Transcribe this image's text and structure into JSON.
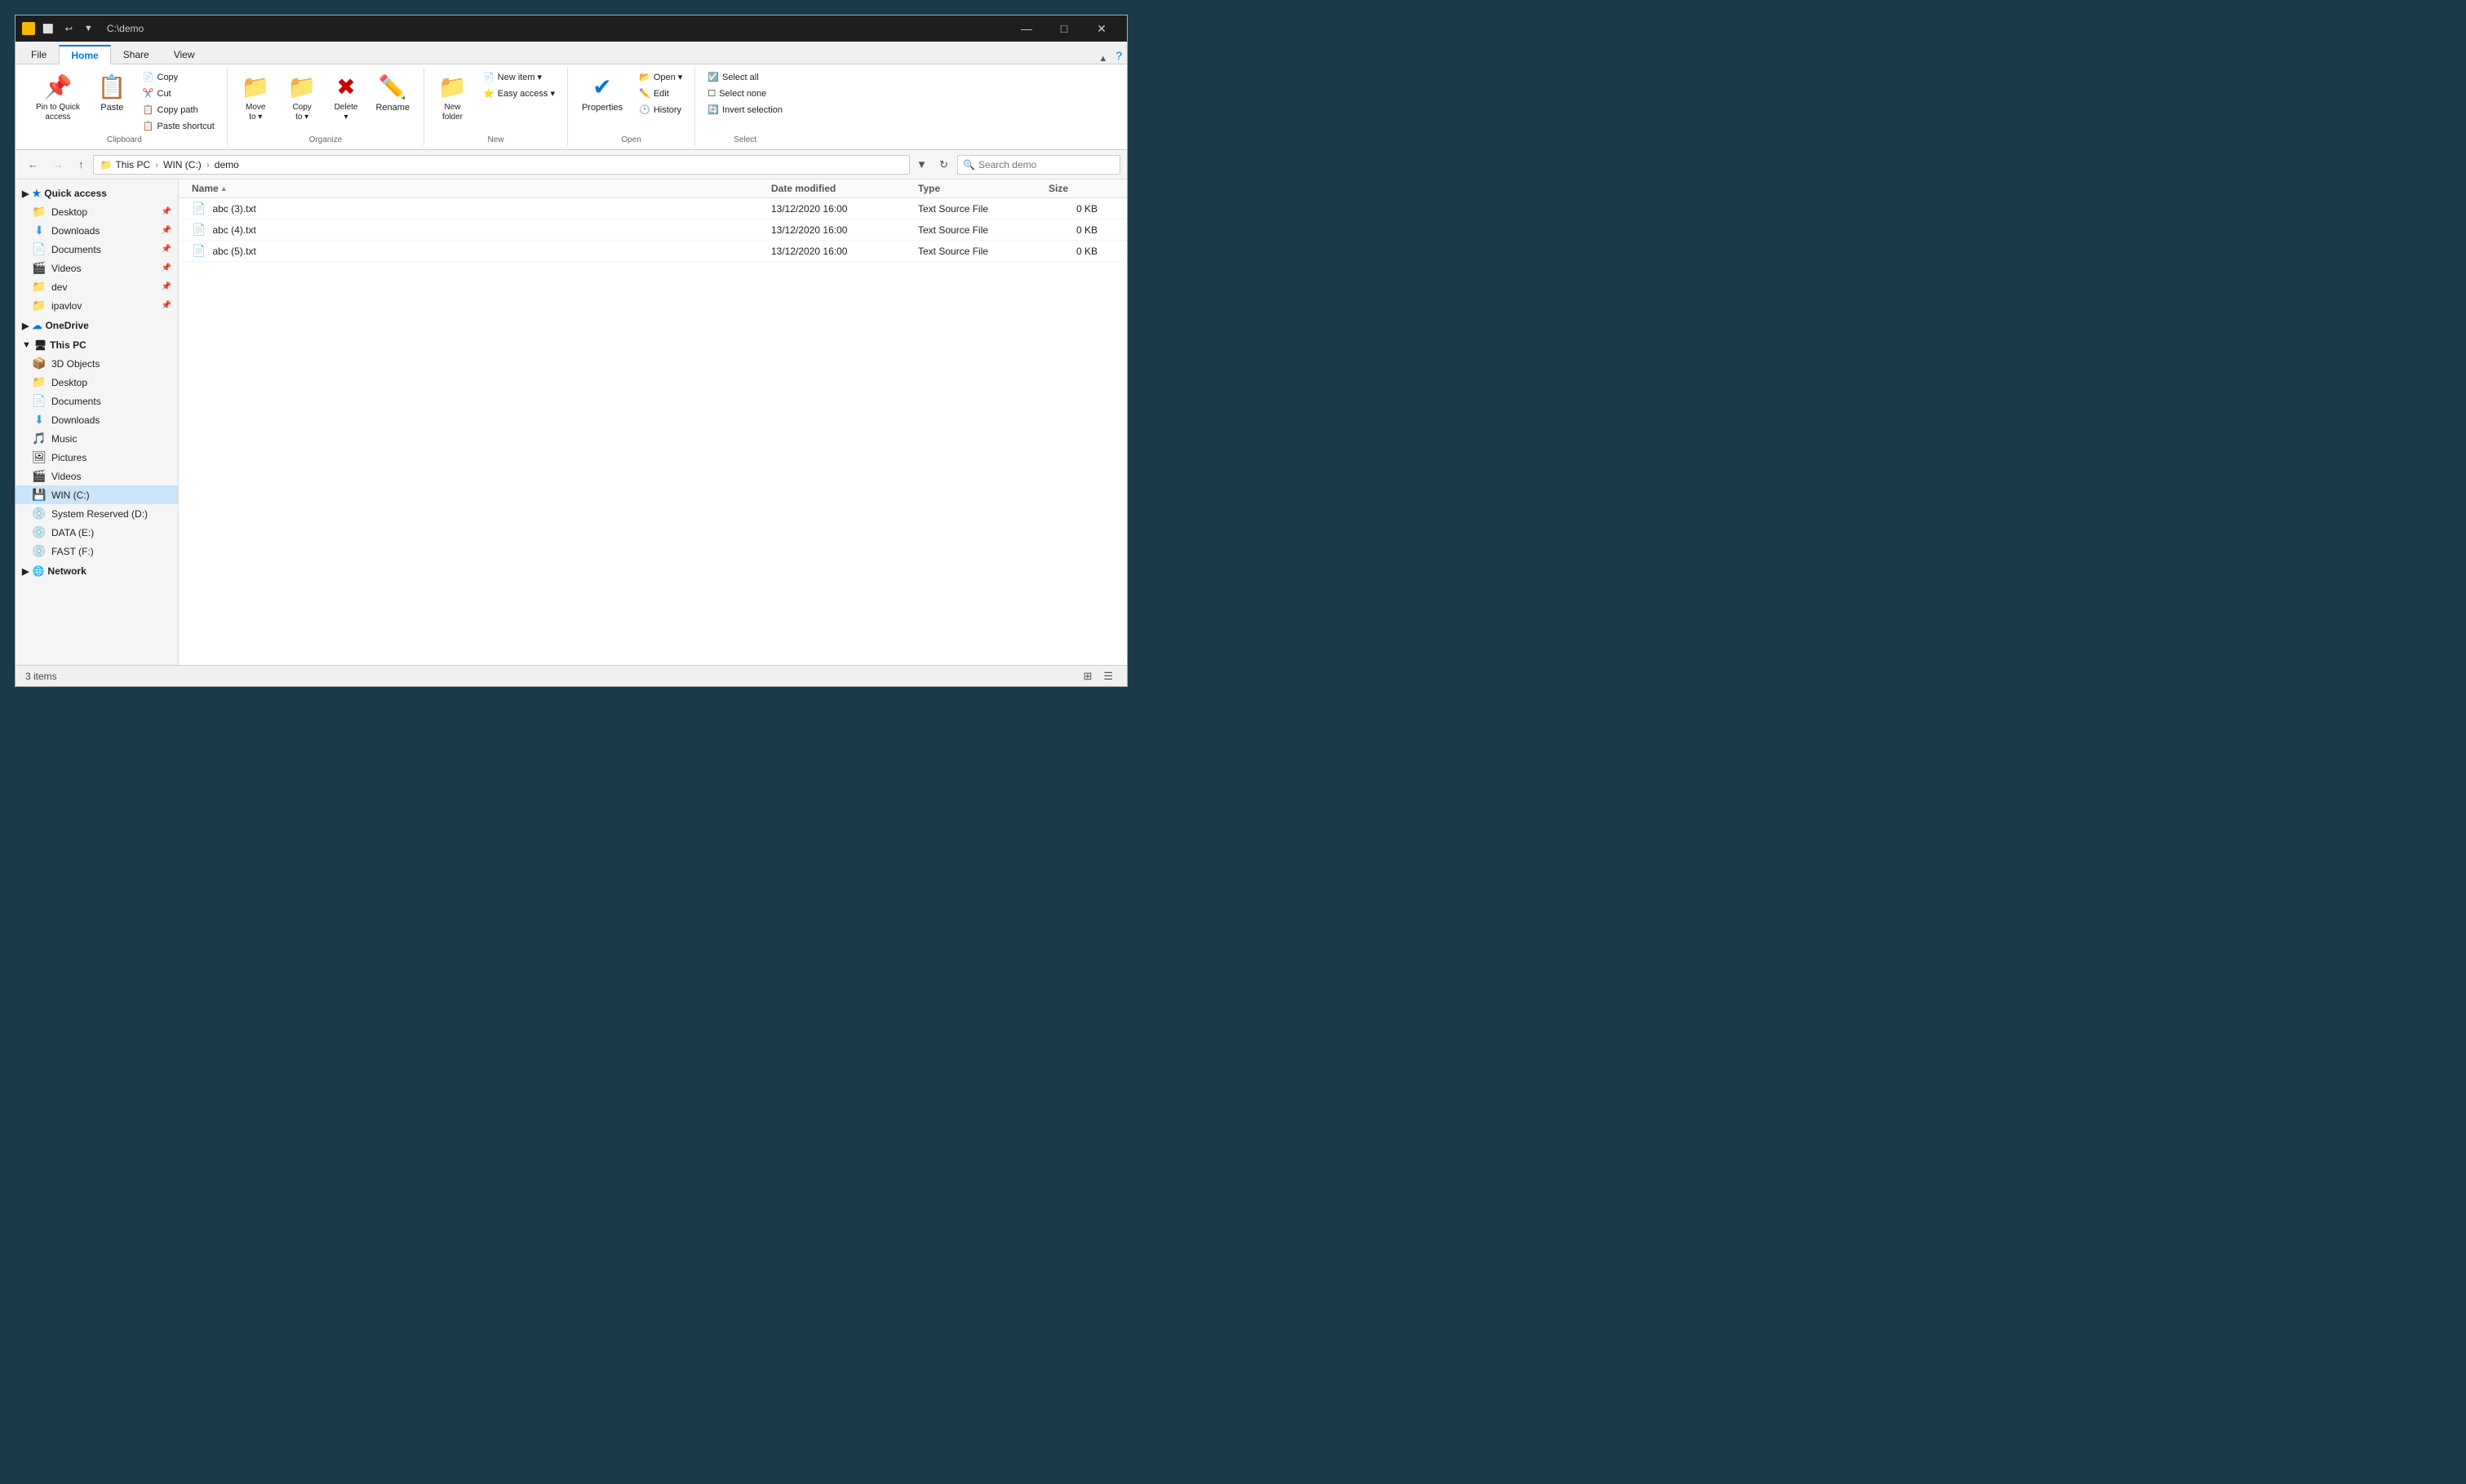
{
  "window": {
    "title": "C:\\demo",
    "path_display": "C:\\demo"
  },
  "title_bar": {
    "minimize": "—",
    "maximize": "□",
    "close": "✕",
    "qs_btns": [
      "⬜",
      "↩",
      "▼"
    ]
  },
  "ribbon": {
    "tabs": [
      {
        "id": "file",
        "label": "File",
        "active": true
      },
      {
        "id": "home",
        "label": "Home",
        "active": false
      },
      {
        "id": "share",
        "label": "Share",
        "active": false
      },
      {
        "id": "view",
        "label": "View",
        "active": false
      }
    ],
    "active_tab": "home",
    "clipboard_group_label": "Clipboard",
    "organize_group_label": "Organize",
    "new_group_label": "New",
    "open_group_label": "Open",
    "select_group_label": "Select",
    "buttons": {
      "pin_to_quick_access": "Pin to Quick\naccess",
      "copy": "Copy",
      "paste": "Paste",
      "cut": "Cut",
      "copy_path": "Copy path",
      "paste_shortcut": "Paste shortcut",
      "move_to": "Move\nto",
      "copy_to": "Copy\nto",
      "delete": "Delete",
      "rename": "Rename",
      "new_folder": "New\nfolder",
      "new_item": "New item ▾",
      "easy_access": "Easy\naccess ▾",
      "properties": "Properties",
      "open": "Open ▾",
      "edit": "Edit",
      "history": "History",
      "select_all": "Select all",
      "select_none": "Select none",
      "invert_selection": "Invert selection"
    }
  },
  "address_bar": {
    "back_disabled": false,
    "forward_disabled": true,
    "up_disabled": false,
    "breadcrumbs": [
      "This PC",
      "WIN (C:)",
      "demo"
    ],
    "search_placeholder": "Search demo"
  },
  "sidebar": {
    "quick_access_label": "Quick access",
    "items_quick": [
      {
        "label": "Desktop",
        "icon": "📁",
        "pinned": true
      },
      {
        "label": "Downloads",
        "icon": "⬇",
        "pinned": true
      },
      {
        "label": "Documents",
        "icon": "📄",
        "pinned": true
      },
      {
        "label": "Videos",
        "icon": "🎬",
        "pinned": true
      },
      {
        "label": "dev",
        "icon": "📁",
        "pinned": true
      },
      {
        "label": "ipavlov",
        "icon": "📁",
        "pinned": true
      }
    ],
    "onedrive_label": "OneDrive",
    "this_pc_label": "This PC",
    "items_pc": [
      {
        "label": "3D Objects",
        "icon": "📦"
      },
      {
        "label": "Desktop",
        "icon": "📁"
      },
      {
        "label": "Documents",
        "icon": "📄"
      },
      {
        "label": "Downloads",
        "icon": "⬇"
      },
      {
        "label": "Music",
        "icon": "🎵"
      },
      {
        "label": "Pictures",
        "icon": "🖼"
      },
      {
        "label": "Videos",
        "icon": "🎬"
      },
      {
        "label": "WIN (C:)",
        "icon": "💾",
        "active": true
      },
      {
        "label": "System Reserved (D:)",
        "icon": "💿"
      },
      {
        "label": "DATA (E:)",
        "icon": "💿"
      },
      {
        "label": "FAST (F:)",
        "icon": "💿"
      }
    ],
    "network_label": "Network"
  },
  "file_list": {
    "headers": [
      {
        "id": "name",
        "label": "Name"
      },
      {
        "id": "date_modified",
        "label": "Date modified"
      },
      {
        "id": "type",
        "label": "Type"
      },
      {
        "id": "size",
        "label": "Size"
      }
    ],
    "files": [
      {
        "name": "abc (3).txt",
        "date_modified": "13/12/2020 16:00",
        "type": "Text Source File",
        "size": "0 KB"
      },
      {
        "name": "abc (4).txt",
        "date_modified": "13/12/2020 16:00",
        "type": "Text Source File",
        "size": "0 KB"
      },
      {
        "name": "abc (5).txt",
        "date_modified": "13/12/2020 16:00",
        "type": "Text Source File",
        "size": "0 KB"
      }
    ]
  },
  "status_bar": {
    "item_count": "3 items",
    "view_details": "⊞",
    "view_list": "☰"
  }
}
